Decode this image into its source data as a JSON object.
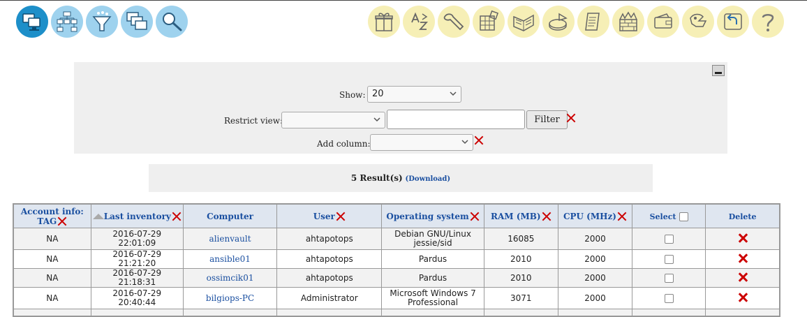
{
  "toolbar": {
    "left_icons": [
      "computers-icon",
      "network-tree-icon",
      "filter-icon",
      "windows-icon",
      "search-icon"
    ],
    "right_icons": [
      "packages-icon",
      "dictionary-icon",
      "config-wrench-icon",
      "inventory-grid-icon",
      "documentation-icon",
      "statistics-pie-icon",
      "notes-icon",
      "security-firewall-icon",
      "wallet-icon",
      "help-hand-icon",
      "logout-icon",
      "help-icon"
    ]
  },
  "filter": {
    "show_label": "Show:",
    "show_value": "20",
    "restrict_label": "Restrict view:",
    "restrict_value": "",
    "restrict_input": "",
    "filter_button": "Filter",
    "add_column_label": "Add column:",
    "add_column_value": ""
  },
  "results": {
    "count_text": "5 Result(s)",
    "download_text": "(Download)"
  },
  "table": {
    "headers": {
      "account_line1": "Account info:",
      "account_line2": "TAG",
      "last_inventory": "Last inventory",
      "computer": "Computer",
      "user": "User",
      "os": "Operating system",
      "ram": "RAM (MB)",
      "cpu": "CPU (MHz)",
      "select": "Select",
      "delete": "Delete"
    },
    "rows": [
      {
        "tag": "NA",
        "last_inventory": "2016-07-29 22:01:09",
        "computer": "alienvault",
        "user": "ahtapotops",
        "os_line1": "Debian GNU/Linux",
        "os_line2": "jessie/sid",
        "ram": "16085",
        "cpu": "2000"
      },
      {
        "tag": "NA",
        "last_inventory": "2016-07-29 21:21:20",
        "computer": "ansible01",
        "user": "ahtapotops",
        "os_line1": "Pardus",
        "os_line2": "",
        "ram": "2010",
        "cpu": "2000"
      },
      {
        "tag": "NA",
        "last_inventory": "2016-07-29 21:18:31",
        "computer": "ossimcik01",
        "user": "ahtapotops",
        "os_line1": "Pardus",
        "os_line2": "",
        "ram": "2010",
        "cpu": "2000"
      },
      {
        "tag": "NA",
        "last_inventory": "2016-07-29 20:40:44",
        "computer": "bilgiops-PC",
        "user": "Administrator",
        "os_line1": "Microsoft Windows 7",
        "os_line2": "Professional",
        "ram": "3071",
        "cpu": "2000"
      }
    ]
  }
}
